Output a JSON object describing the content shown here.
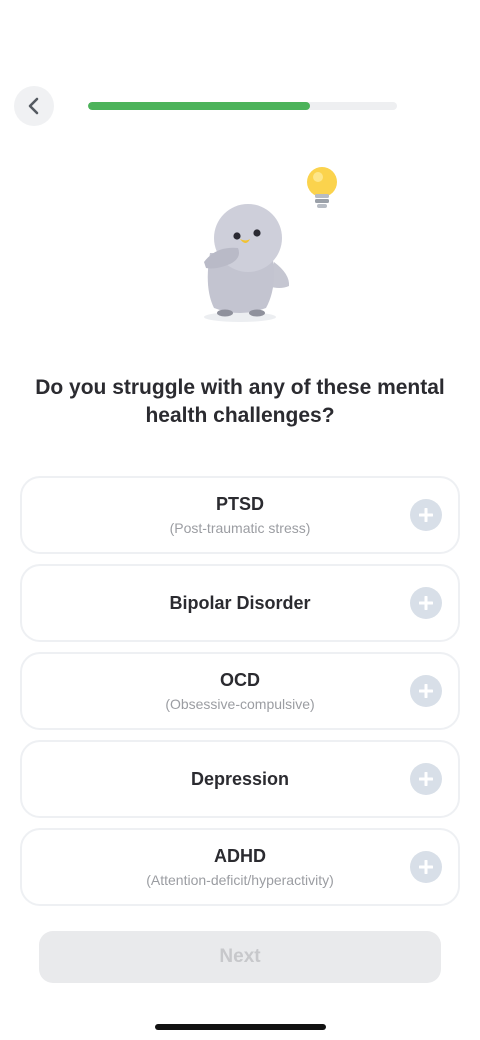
{
  "header": {
    "back_icon": "chevron-left-icon",
    "progress": 0.72,
    "progress_color": "#4cb35a"
  },
  "illustration": {
    "mascot": "thinking-penguin",
    "accent_icon": "lightbulb-icon"
  },
  "question": "Do you struggle with any of these mental health challenges?",
  "options": [
    {
      "title": "PTSD",
      "subtitle": "(Post-traumatic stress)"
    },
    {
      "title": "Bipolar Disorder",
      "subtitle": ""
    },
    {
      "title": "OCD",
      "subtitle": "(Obsessive-compulsive)"
    },
    {
      "title": "Depression",
      "subtitle": ""
    },
    {
      "title": "ADHD",
      "subtitle": "(Attention-deficit/hyperactivity)"
    }
  ],
  "option_action_icon": "plus-icon",
  "next_button": {
    "label": "Next",
    "enabled": false
  }
}
